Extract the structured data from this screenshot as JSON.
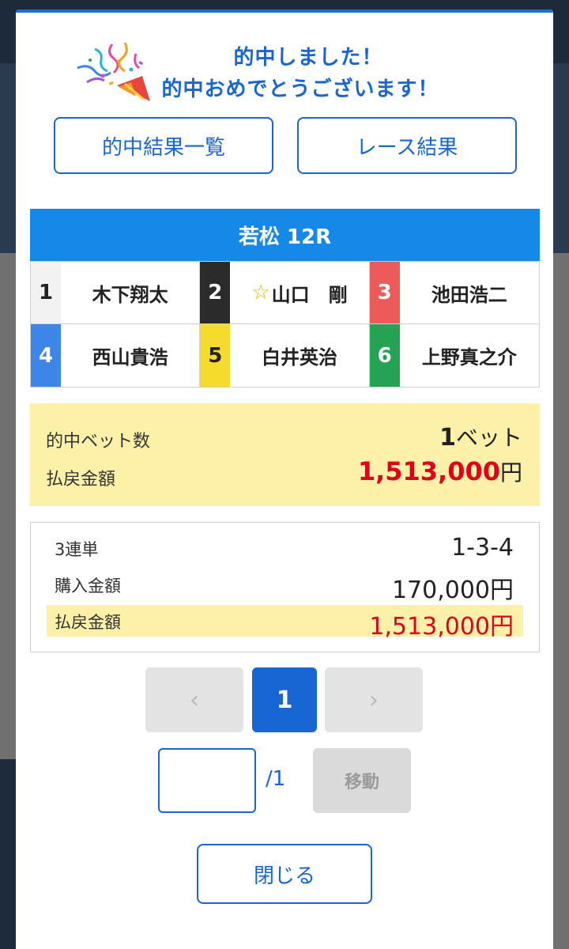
{
  "hit": {
    "line1": "的中しました！",
    "line2": "的中おめでとうございます！"
  },
  "buttons": {
    "hit_list": "的中結果一覧",
    "race_result": "レース結果",
    "close": "閉じる"
  },
  "race": {
    "title": "若松 12R",
    "racers": [
      {
        "num": "1",
        "name": "木下翔太",
        "bg": "#f2f2f2",
        "fg": "#222222",
        "star": false
      },
      {
        "num": "2",
        "name": "山口　剛",
        "bg": "#2b2b2b",
        "fg": "#ffffff",
        "star": true
      },
      {
        "num": "3",
        "name": "池田浩二",
        "bg": "#ec5a5a",
        "fg": "#ffffff",
        "star": false
      },
      {
        "num": "4",
        "name": "西山貴浩",
        "bg": "#3d86e8",
        "fg": "#ffffff",
        "star": false
      },
      {
        "num": "5",
        "name": "白井英治",
        "bg": "#f5dc2c",
        "fg": "#222222",
        "star": false
      },
      {
        "num": "6",
        "name": "上野真之介",
        "bg": "#25a353",
        "fg": "#ffffff",
        "star": false
      }
    ]
  },
  "summary": {
    "bets_label": "的中ベット数",
    "bets_value": "1",
    "bets_unit": "ベット",
    "payout_label": "払戻金額",
    "payout_value": "1,513,000",
    "payout_unit": "円"
  },
  "detail": {
    "bet_type": "3連単",
    "combination": "1-3-4",
    "purchase_label": "購入金額",
    "purchase_value": "170,000円",
    "payout_label": "払戻金額",
    "payout_value": "1,513,000円"
  },
  "pagination": {
    "prev": "‹",
    "current": "1",
    "next": "›",
    "total": "/1",
    "jump_label": "移動",
    "jump_value": ""
  },
  "colors": {
    "accent": "#1766d4",
    "header_blue": "#1689e8",
    "highlight_yellow": "#fdf1a9",
    "payout_red": "#e0001a"
  }
}
